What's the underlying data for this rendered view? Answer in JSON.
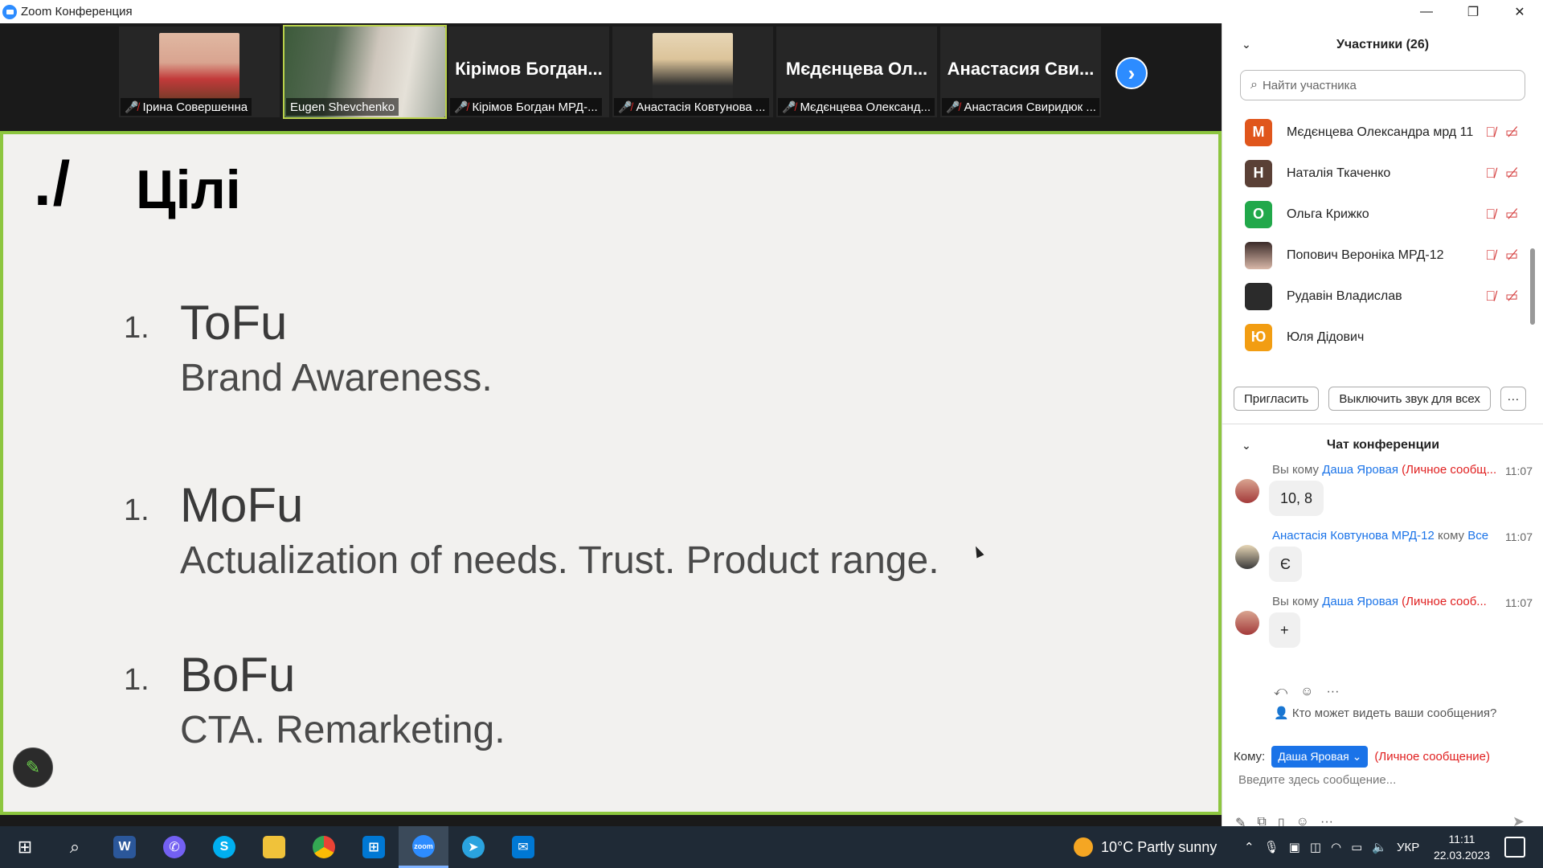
{
  "window": {
    "title": "Zoom Конференция",
    "controls": [
      "—",
      "❐",
      "✕"
    ]
  },
  "thumbnails": [
    {
      "name": "Ірина Совершенна",
      "muted": true,
      "type": "photo1"
    },
    {
      "name": "Eugen Shevchenko",
      "muted": false,
      "type": "photo2",
      "active": true
    },
    {
      "big": "Кірімов Богдан...",
      "name": "Кірімов Богдан МРД-...",
      "muted": true
    },
    {
      "name": "Анастасія Ковтунова ...",
      "muted": true,
      "type": "photo3"
    },
    {
      "big": "Мєдєнцева Ол...",
      "name": "Мєдєнцева Олександ...",
      "muted": true
    },
    {
      "big": "Анастасия Сви...",
      "name": "Анастасия Свиридюк ...",
      "muted": true
    }
  ],
  "slide": {
    "mark": "./",
    "title": "Цілі",
    "items": [
      {
        "num": "1.",
        "head": "ToFu",
        "sub": "Brand Awareness."
      },
      {
        "num": "1.",
        "head": "MoFu",
        "sub": "Actualization of needs. Trust. Product range."
      },
      {
        "num": "1.",
        "head": "BoFu",
        "sub": "CTA. Remarketing."
      }
    ]
  },
  "participants": {
    "header": "Участники (26)",
    "search_placeholder": "Найти участника",
    "list": [
      {
        "initial": "М",
        "name": "Мєдєнцева Олександра мрд 11",
        "color": "#e0561c",
        "muted": true
      },
      {
        "initial": "Н",
        "name": "Наталія Ткаченко",
        "color": "#5a4036",
        "muted": true
      },
      {
        "initial": "О",
        "name": "Ольга Крижко",
        "color": "#21a84a",
        "muted": true
      },
      {
        "initial": "",
        "name": "Попович Вероніка МРД-12",
        "color": "#6b5a55",
        "muted": true
      },
      {
        "initial": "",
        "name": "Рудавін Владислав",
        "color": "#2b2b2b",
        "muted": true
      },
      {
        "initial": "Ю",
        "name": "Юля Дідович",
        "color": "#f29d12",
        "muted": false
      }
    ],
    "actions": {
      "invite": "Пригласить",
      "mute_all": "Выключить звук для всех",
      "more": "···"
    }
  },
  "chat": {
    "header": "Чат конференции",
    "messages": [
      {
        "from": "Вы кому ",
        "to": "Даша Яровая",
        "priv": " (Личное сообщ...",
        "time": "11:07",
        "text": "10, 8"
      },
      {
        "from": "",
        "to": "Анастасія Ковтунова МРД-12",
        "mid": " кому ",
        "to2": "Все",
        "time": "11:07",
        "text": "Є"
      },
      {
        "from": "Вы кому ",
        "to": "Даша Яровая",
        "priv": " (Личное сооб...",
        "time": "11:07",
        "text": "+"
      }
    ],
    "who_can_see": "Кто может видеть ваши сообщения?",
    "to_label": "Кому:",
    "to_value": "Даша Яровая",
    "private_note": "(Личное сообщение)",
    "input_placeholder": "Введите здесь сообщение..."
  },
  "taskbar": {
    "weather": "10°C  Partly sunny",
    "lang": "УКР",
    "time": "11:11",
    "date": "22.03.2023"
  }
}
